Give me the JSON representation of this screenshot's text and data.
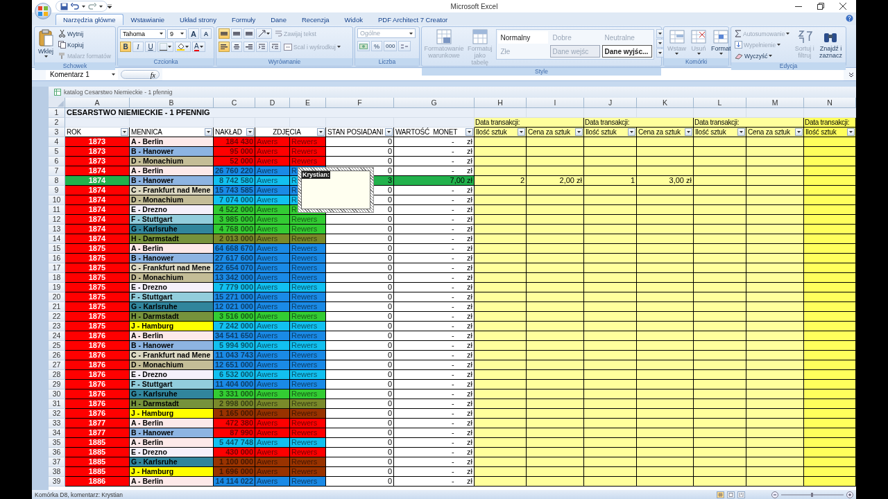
{
  "window": {
    "title": "Microsoft Excel"
  },
  "tabs": [
    {
      "label": "Narzędzia główne",
      "selected": true
    },
    {
      "label": "Wstawianie",
      "selected": false
    },
    {
      "label": "Układ strony",
      "selected": false
    },
    {
      "label": "Formuły",
      "selected": false
    },
    {
      "label": "Dane",
      "selected": false
    },
    {
      "label": "Recenzja",
      "selected": false
    },
    {
      "label": "Widok",
      "selected": false
    },
    {
      "label": "PDF Architect 7 Creator",
      "selected": false
    }
  ],
  "ribbon": {
    "groups": [
      {
        "kind": "clipboard",
        "label": "Schowek",
        "paste": {
          "label": "Wklej",
          "disabled": false
        },
        "actions": [
          {
            "label": "Wytnij",
            "disabled": false
          },
          {
            "label": "Kopiuj",
            "disabled": false
          },
          {
            "label": "Malarz formatów",
            "disabled": true
          }
        ]
      },
      {
        "kind": "font",
        "label": "Czcionka",
        "font": "Tahoma",
        "size": "9",
        "grow": "A",
        "shrink": "A",
        "styles": [
          {
            "label": "B",
            "selected": true
          },
          {
            "label": "I",
            "selected": false
          },
          {
            "label": "U",
            "selected": false
          }
        ],
        "color_button": "A"
      },
      {
        "kind": "alignment",
        "label": "Wyrównanie",
        "vertical": [
          {
            "selected": true
          },
          {
            "selected": false
          },
          {
            "selected": false
          }
        ],
        "horizontal": [
          {
            "selected": true
          },
          {
            "selected": false
          },
          {
            "selected": false
          }
        ],
        "actions": [
          {
            "label": "Zawijaj tekst",
            "disabled": true
          },
          {
            "label": "Scal i wyśrodkuj",
            "disabled": true
          }
        ]
      },
      {
        "kind": "number",
        "label": "Liczba",
        "format": {
          "value": "Ogólne",
          "disabled": true
        },
        "percent": "%",
        "thousands": "000"
      },
      {
        "kind": "styles",
        "label": "Style",
        "actions": [
          {
            "label": "Formatowanie warunkowe",
            "disabled": true
          },
          {
            "label": "Formatuj jako tabelę",
            "disabled": true
          }
        ],
        "gallery": [
          {
            "label": "Normalny",
            "kind": "normal",
            "disabled": false
          },
          {
            "label": "Dobre",
            "kind": "plain",
            "disabled": true
          },
          {
            "label": "Neutralne",
            "kind": "plain",
            "disabled": true
          },
          {
            "label": "Złe",
            "kind": "plain",
            "disabled": true
          },
          {
            "label": "Dane wejśc",
            "kind": "input",
            "disabled": true
          },
          {
            "label": "Dane wyjśc...",
            "kind": "output",
            "disabled": false
          }
        ]
      },
      {
        "kind": "cells",
        "label": "Komórki",
        "actions": [
          {
            "label": "Wstaw",
            "disabled": true
          },
          {
            "label": "Usuń",
            "disabled": true
          },
          {
            "label": "Format",
            "disabled": false
          }
        ]
      },
      {
        "kind": "editing",
        "label": "Edycja",
        "actions": [
          {
            "label": "Autosumowanie",
            "disabled": true
          },
          {
            "label": "Wypełnienie",
            "disabled": true
          },
          {
            "label": "Wyczyść",
            "disabled": false
          }
        ],
        "large": [
          {
            "label": "Sortuj i filtruj",
            "disabled": true
          },
          {
            "label": "Znajdź i zaznacz",
            "disabled": false
          }
        ]
      }
    ]
  },
  "formula_bar": {
    "name_box": "Komentarz 1",
    "function_label": "fx"
  },
  "sheet": {
    "title": "katalog Cesarstwo Niemieckie - 1 pfennig",
    "columns": [
      "A",
      "B",
      "C",
      "D",
      "E",
      "F",
      "G",
      "H",
      "I",
      "J",
      "K",
      "L",
      "M",
      "N"
    ],
    "heading": {
      "row": "1",
      "text": "CESARSTWO NIEMIECKIE - 1 PFENNIG"
    },
    "transaction_row": {
      "row": "2",
      "labels": [
        "Data transakcji:",
        "Data transakcji:",
        "Data transakcji:",
        "Data transakcji:"
      ]
    },
    "header_row": {
      "row": "3",
      "headers": [
        "ROK",
        "MENNICA",
        "NAKŁAD",
        "ZDJĘCIA",
        "STAN POSIADANI",
        "WARTOŚĆ  MONET",
        "Ilość sztuk",
        "Cena za sztuk",
        "Ilość sztuk",
        "Cena za sztuk",
        "Ilość sztuk",
        "Cena za sztuk",
        "Ilość sztuk"
      ]
    },
    "rows": [
      {
        "row": "4",
        "year": {
          "text": "1873",
          "color": "#ff0000"
        },
        "mint": {
          "text": "A - Berlin",
          "color": "#fde9e9"
        },
        "mintage": {
          "text": "184 430",
          "color": "#ff0000"
        },
        "obverse": "Awers",
        "reverse": "Rewers",
        "stock": "0",
        "amount": "-",
        "unit": "zł",
        "color": "#ffffff"
      },
      {
        "row": "5",
        "year": {
          "text": "1873",
          "color": "#ff0000"
        },
        "mint": {
          "text": "B - Hanower",
          "color": "#8db4e2"
        },
        "mintage": {
          "text": "95 000",
          "color": "#ff0000"
        },
        "obverse": "Awers",
        "reverse": "Rewers",
        "stock": "0",
        "amount": "-",
        "unit": "zł",
        "color": "#ffffff"
      },
      {
        "row": "6",
        "year": {
          "text": "1873",
          "color": "#ff0000"
        },
        "mint": {
          "text": "D - Monachium",
          "color": "#c4bd97"
        },
        "mintage": {
          "text": "52 000",
          "color": "#ff0000"
        },
        "obverse": "Awers",
        "reverse": "Rewers",
        "stock": "0",
        "amount": "-",
        "unit": "zł",
        "color": "#ffffff"
      },
      {
        "row": "7",
        "year": {
          "text": "1874",
          "color": "#ff0000"
        },
        "mint": {
          "text": "A - Berlin",
          "color": "#fde9e9"
        },
        "mintage": {
          "text": "26 760 220",
          "color": "#1a8ae6"
        },
        "obverse": "Awers",
        "reverse": "R",
        "stock": "0",
        "amount": "-",
        "unit": "zł",
        "color": "#ffffff"
      },
      {
        "row": "8",
        "year": {
          "text": "1874",
          "color": "#22b14c"
        },
        "mint": {
          "text": "B - Hanower",
          "color": "#8db4e2"
        },
        "mintage": {
          "text": "8 742 580",
          "color": "#12c0f0"
        },
        "obverse": "Awers",
        "reverse": "R",
        "stock": "3",
        "amount": "7,00",
        "unit": "zł",
        "color": "#22b14c",
        "transactions": [
          "2",
          "2,00 zł",
          "1",
          "3,00 zł"
        ]
      },
      {
        "row": "9",
        "year": {
          "text": "1874",
          "color": "#ff0000"
        },
        "mint": {
          "text": "C - Frankfurt nad Mene",
          "color": "#ddd9c3"
        },
        "mintage": {
          "text": "15 743 585",
          "color": "#1a8ae6"
        },
        "obverse": "Awers",
        "reverse": "R",
        "stock": "0",
        "amount": "-",
        "unit": "zł",
        "color": "#ffffff"
      },
      {
        "row": "10",
        "year": {
          "text": "1874",
          "color": "#ff0000"
        },
        "mint": {
          "text": "D - Monachium",
          "color": "#c4bd97"
        },
        "mintage": {
          "text": "7 074 000",
          "color": "#12c0f0"
        },
        "obverse": "Awers",
        "reverse": "R",
        "stock": "0",
        "amount": "-",
        "unit": "zł",
        "color": "#ffffff"
      },
      {
        "row": "11",
        "year": {
          "text": "1874",
          "color": "#ff0000"
        },
        "mint": {
          "text": "E - Drezno",
          "color": "#f5f0fa"
        },
        "mintage": {
          "text": "4 522 000",
          "color": "#33cc33"
        },
        "obverse": "Awers",
        "reverse": "R",
        "stock": "0",
        "amount": "-",
        "unit": "zł",
        "color": "#ffffff"
      },
      {
        "row": "12",
        "year": {
          "text": "1874",
          "color": "#ff0000"
        },
        "mint": {
          "text": "F - Stuttgart",
          "color": "#92cddc"
        },
        "mintage": {
          "text": "3 985 000",
          "color": "#33cc33"
        },
        "obverse": "Awers",
        "reverse": "Rewers",
        "stock": "0",
        "amount": "-",
        "unit": "zł",
        "color": "#ffffff"
      },
      {
        "row": "13",
        "year": {
          "text": "1874",
          "color": "#ff0000"
        },
        "mint": {
          "text": "G - Karlsruhe",
          "color": "#31859c"
        },
        "mintage": {
          "text": "4 768 000",
          "color": "#33cc33"
        },
        "obverse": "Awers",
        "reverse": "Rewers",
        "stock": "0",
        "amount": "-",
        "unit": "zł",
        "color": "#ffffff"
      },
      {
        "row": "14",
        "year": {
          "text": "1874",
          "color": "#ff0000"
        },
        "mint": {
          "text": "H - Darmstadt",
          "color": "#76923c"
        },
        "mintage": {
          "text": "2 013 000",
          "color": "#7a8a2a"
        },
        "obverse": "Awers",
        "reverse": "Rewers",
        "stock": "0",
        "amount": "-",
        "unit": "zł",
        "color": "#ffffff"
      },
      {
        "row": "15",
        "year": {
          "text": "1875",
          "color": "#ff0000"
        },
        "mint": {
          "text": "A - Berlin",
          "color": "#fde9e9"
        },
        "mintage": {
          "text": "64 668 670",
          "color": "#1a8ae6"
        },
        "obverse": "Awers",
        "reverse": "Rewers",
        "stock": "0",
        "amount": "-",
        "unit": "zł",
        "color": "#ffffff"
      },
      {
        "row": "16",
        "year": {
          "text": "1875",
          "color": "#ff0000"
        },
        "mint": {
          "text": "B - Hanower",
          "color": "#8db4e2"
        },
        "mintage": {
          "text": "27 617 600",
          "color": "#1a8ae6"
        },
        "obverse": "Awers",
        "reverse": "Rewers",
        "stock": "0",
        "amount": "-",
        "unit": "zł",
        "color": "#ffffff"
      },
      {
        "row": "17",
        "year": {
          "text": "1875",
          "color": "#ff0000"
        },
        "mint": {
          "text": "C - Frankfurt nad Mene",
          "color": "#ddd9c3"
        },
        "mintage": {
          "text": "22 654 070",
          "color": "#1a8ae6"
        },
        "obverse": "Awers",
        "reverse": "Rewers",
        "stock": "0",
        "amount": "-",
        "unit": "zł",
        "color": "#ffffff"
      },
      {
        "row": "18",
        "year": {
          "text": "1875",
          "color": "#ff0000"
        },
        "mint": {
          "text": "D - Monachium",
          "color": "#c4bd97"
        },
        "mintage": {
          "text": "13 342 000",
          "color": "#1a8ae6"
        },
        "obverse": "Awers",
        "reverse": "Rewers",
        "stock": "0",
        "amount": "-",
        "unit": "zł",
        "color": "#ffffff"
      },
      {
        "row": "19",
        "year": {
          "text": "1875",
          "color": "#ff0000"
        },
        "mint": {
          "text": "E - Drezno",
          "color": "#f5f0fa"
        },
        "mintage": {
          "text": "7 779 000",
          "color": "#12c0f0"
        },
        "obverse": "Awers",
        "reverse": "Rewers",
        "stock": "0",
        "amount": "-",
        "unit": "zł",
        "color": "#ffffff"
      },
      {
        "row": "20",
        "year": {
          "text": "1875",
          "color": "#ff0000"
        },
        "mint": {
          "text": "F - Stuttgart",
          "color": "#92cddc"
        },
        "mintage": {
          "text": "15 271 000",
          "color": "#1a8ae6"
        },
        "obverse": "Awers",
        "reverse": "Rewers",
        "stock": "0",
        "amount": "-",
        "unit": "zł",
        "color": "#ffffff"
      },
      {
        "row": "21",
        "year": {
          "text": "1875",
          "color": "#ff0000"
        },
        "mint": {
          "text": "G - Karlsruhe",
          "color": "#31859c"
        },
        "mintage": {
          "text": "12 021 000",
          "color": "#1a8ae6"
        },
        "obverse": "Awers",
        "reverse": "Rewers",
        "stock": "0",
        "amount": "-",
        "unit": "zł",
        "color": "#ffffff"
      },
      {
        "row": "22",
        "year": {
          "text": "1875",
          "color": "#ff0000"
        },
        "mint": {
          "text": "H - Darmstadt",
          "color": "#76923c"
        },
        "mintage": {
          "text": "3 516 000",
          "color": "#33cc33"
        },
        "obverse": "Awers",
        "reverse": "Rewers",
        "stock": "0",
        "amount": "-",
        "unit": "zł",
        "color": "#ffffff"
      },
      {
        "row": "23",
        "year": {
          "text": "1875",
          "color": "#ff0000"
        },
        "mint": {
          "text": "J - Hamburg",
          "color": "#ffff00"
        },
        "mintage": {
          "text": "7 242 000",
          "color": "#12c0f0"
        },
        "obverse": "Awers",
        "reverse": "Rewers",
        "stock": "0",
        "amount": "-",
        "unit": "zł",
        "color": "#ffffff"
      },
      {
        "row": "24",
        "year": {
          "text": "1876",
          "color": "#ff0000"
        },
        "mint": {
          "text": "A - Berlin",
          "color": "#fde9e9"
        },
        "mintage": {
          "text": "34 541 650",
          "color": "#1a8ae6"
        },
        "obverse": "Awers",
        "reverse": "Rewers",
        "stock": "0",
        "amount": "-",
        "unit": "zł",
        "color": "#ffffff"
      },
      {
        "row": "25",
        "year": {
          "text": "1876",
          "color": "#ff0000"
        },
        "mint": {
          "text": "B - Hanower",
          "color": "#8db4e2"
        },
        "mintage": {
          "text": "5 994 900",
          "color": "#12c0f0"
        },
        "obverse": "Awers",
        "reverse": "Rewers",
        "stock": "0",
        "amount": "-",
        "unit": "zł",
        "color": "#ffffff"
      },
      {
        "row": "26",
        "year": {
          "text": "1876",
          "color": "#ff0000"
        },
        "mint": {
          "text": "C - Frankfurt nad Mene",
          "color": "#ddd9c3"
        },
        "mintage": {
          "text": "11 043 743",
          "color": "#1a8ae6"
        },
        "obverse": "Awers",
        "reverse": "Rewers",
        "stock": "0",
        "amount": "-",
        "unit": "zł",
        "color": "#ffffff"
      },
      {
        "row": "27",
        "year": {
          "text": "1876",
          "color": "#ff0000"
        },
        "mint": {
          "text": "D - Monachium",
          "color": "#c4bd97"
        },
        "mintage": {
          "text": "12 651 000",
          "color": "#1a8ae6"
        },
        "obverse": "Awers",
        "reverse": "Rewers",
        "stock": "0",
        "amount": "-",
        "unit": "zł",
        "color": "#ffffff"
      },
      {
        "row": "28",
        "year": {
          "text": "1876",
          "color": "#ff0000"
        },
        "mint": {
          "text": "E - Drezno",
          "color": "#f5f0fa"
        },
        "mintage": {
          "text": "6 532 000",
          "color": "#12c0f0"
        },
        "obverse": "Awers",
        "reverse": "Rewers",
        "stock": "0",
        "amount": "-",
        "unit": "zł",
        "color": "#ffffff"
      },
      {
        "row": "29",
        "year": {
          "text": "1876",
          "color": "#ff0000"
        },
        "mint": {
          "text": "F - Stuttgart",
          "color": "#92cddc"
        },
        "mintage": {
          "text": "11 404 000",
          "color": "#1a8ae6"
        },
        "obverse": "Awers",
        "reverse": "Rewers",
        "stock": "0",
        "amount": "-",
        "unit": "zł",
        "color": "#ffffff"
      },
      {
        "row": "30",
        "year": {
          "text": "1876",
          "color": "#ff0000"
        },
        "mint": {
          "text": "G - Karlsruhe",
          "color": "#31859c"
        },
        "mintage": {
          "text": "3 331 000",
          "color": "#33cc33"
        },
        "obverse": "Awers",
        "reverse": "Rewers",
        "stock": "0",
        "amount": "-",
        "unit": "zł",
        "color": "#ffffff"
      },
      {
        "row": "31",
        "year": {
          "text": "1876",
          "color": "#ff0000"
        },
        "mint": {
          "text": "H - Darmstadt",
          "color": "#76923c"
        },
        "mintage": {
          "text": "2 998 000",
          "color": "#7a8a2a"
        },
        "obverse": "Awers",
        "reverse": "Rewers",
        "stock": "0",
        "amount": "-",
        "unit": "zł",
        "color": "#ffffff"
      },
      {
        "row": "32",
        "year": {
          "text": "1876",
          "color": "#ff0000"
        },
        "mint": {
          "text": "J - Hamburg",
          "color": "#ffff00"
        },
        "mintage": {
          "text": "1 165 000",
          "color": "#993300"
        },
        "obverse": "Awers",
        "reverse": "Rewers",
        "stock": "0",
        "amount": "-",
        "unit": "zł",
        "color": "#ffffff"
      },
      {
        "row": "33",
        "year": {
          "text": "1877",
          "color": "#ff0000"
        },
        "mint": {
          "text": "A - Berlin",
          "color": "#fde9e9"
        },
        "mintage": {
          "text": "472 380",
          "color": "#ff0000"
        },
        "obverse": "Awers",
        "reverse": "Rewers",
        "stock": "0",
        "amount": "-",
        "unit": "zł",
        "color": "#ffffff"
      },
      {
        "row": "34",
        "year": {
          "text": "1877",
          "color": "#ff0000"
        },
        "mint": {
          "text": "B - Hanower",
          "color": "#8db4e2"
        },
        "mintage": {
          "text": "87 990",
          "color": "#ff0000"
        },
        "obverse": "Awers",
        "reverse": "Rewers",
        "stock": "0",
        "amount": "-",
        "unit": "zł",
        "color": "#ffffff"
      },
      {
        "row": "35",
        "year": {
          "text": "1885",
          "color": "#ff0000"
        },
        "mint": {
          "text": "A - Berlin",
          "color": "#fde9e9"
        },
        "mintage": {
          "text": "5 447 748",
          "color": "#12c0f0"
        },
        "obverse": "Awers",
        "reverse": "Rewers",
        "stock": "0",
        "amount": "-",
        "unit": "zł",
        "color": "#ffffff"
      },
      {
        "row": "36",
        "year": {
          "text": "1885",
          "color": "#ff0000"
        },
        "mint": {
          "text": "E - Drezno",
          "color": "#f5f0fa"
        },
        "mintage": {
          "text": "430 000",
          "color": "#ff0000"
        },
        "obverse": "Awers",
        "reverse": "Rewers",
        "stock": "0",
        "amount": "-",
        "unit": "zł",
        "color": "#ffffff"
      },
      {
        "row": "37",
        "year": {
          "text": "1885",
          "color": "#ff0000"
        },
        "mint": {
          "text": "G - Karlsruhe",
          "color": "#31859c"
        },
        "mintage": {
          "text": "1 100 000",
          "color": "#993300"
        },
        "obverse": "Awers",
        "reverse": "Rewers",
        "stock": "0",
        "amount": "-",
        "unit": "zł",
        "color": "#ffffff"
      },
      {
        "row": "38",
        "year": {
          "text": "1885",
          "color": "#ff0000"
        },
        "mint": {
          "text": "J - Hamburg",
          "color": "#ffff00"
        },
        "mintage": {
          "text": "1 696 000",
          "color": "#993300"
        },
        "obverse": "Awers",
        "reverse": "Rewers",
        "stock": "0",
        "amount": "-",
        "unit": "zł",
        "color": "#ffffff"
      },
      {
        "row": "39",
        "year": {
          "text": "1886",
          "color": "#ff0000"
        },
        "mint": {
          "text": "A - Berlin",
          "color": "#fde9e9"
        },
        "mintage": {
          "text": "14 114 022",
          "color": "#1a8ae6"
        },
        "obverse": "Awers",
        "reverse": "Rewers",
        "stock": "0",
        "amount": "-",
        "unit": "zł",
        "color": "#ffffff"
      }
    ],
    "comment": {
      "author": "Krystian:"
    }
  },
  "status_bar": {
    "text": "Komórka D8, komentarz: Krystian"
  }
}
